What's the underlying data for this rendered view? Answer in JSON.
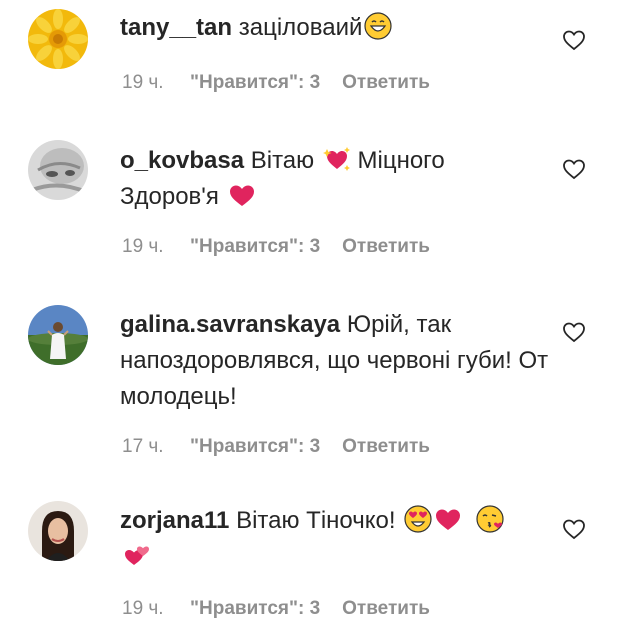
{
  "comments": [
    {
      "username": "tany__tan",
      "text": " заціловаий",
      "emojis": [
        "grinning-face"
      ],
      "time": "19 ч.",
      "likes": "\"Нравится\": 3",
      "reply": "Ответить"
    },
    {
      "username": "o_kovbasa",
      "text": " Вітаю ",
      "text2": " Міцного Здоров'я ",
      "emojis": [
        "sparkling-heart",
        "red-heart"
      ],
      "time": "19 ч.",
      "likes": "\"Нравится\": 3",
      "reply": "Ответить"
    },
    {
      "username": "galina.savranskaya",
      "text": " Юрій, так напоздоровлявся, що червоні губи! От молодець!",
      "time": "17 ч.",
      "likes": "\"Нравится\": 3",
      "reply": "Ответить"
    },
    {
      "username": "zorjana11",
      "text": " Вітаю Тіночко! ",
      "emojis": [
        "heart-eyes",
        "red-heart",
        "face-blowing-kiss",
        "two-hearts"
      ],
      "time": "19 ч.",
      "likes": "\"Нравится\": 3",
      "reply": "Ответить"
    }
  ],
  "colors": {
    "text": "#262626",
    "meta": "#8e8e8e",
    "heart_red": "#e0245e"
  }
}
